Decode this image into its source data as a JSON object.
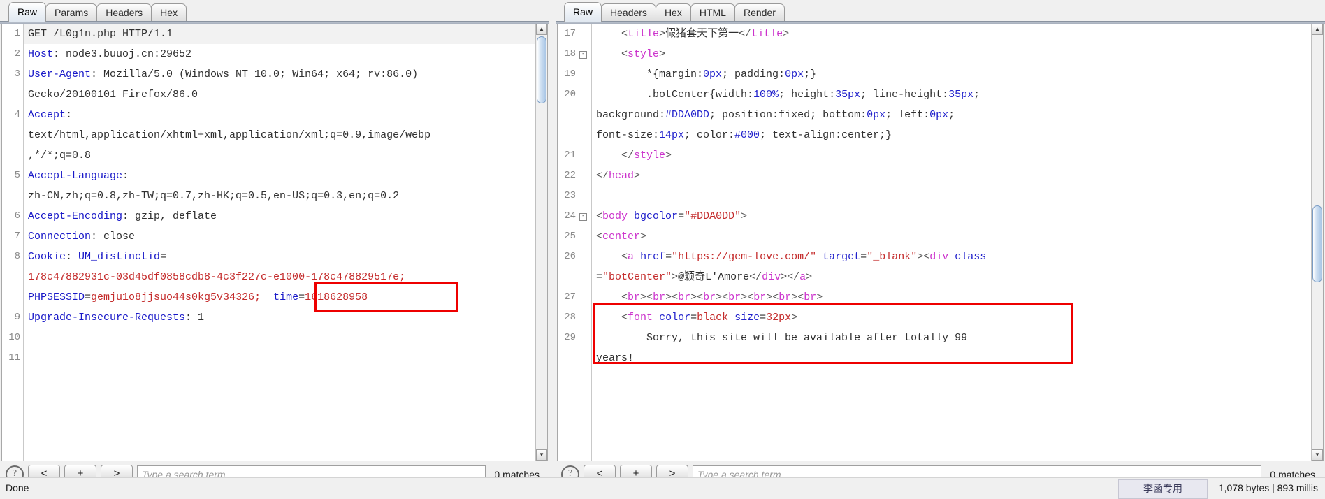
{
  "request": {
    "tabs": [
      {
        "label": "Raw",
        "active": true
      },
      {
        "label": "Params",
        "active": false
      },
      {
        "label": "Headers",
        "active": false
      },
      {
        "label": "Hex",
        "active": false
      }
    ],
    "lines": [
      {
        "n": "1",
        "segments": [
          {
            "t": "GET /L0g1n.php HTTP/1.1",
            "c": "k-plain"
          }
        ]
      },
      {
        "n": "2",
        "segments": [
          {
            "t": "Host",
            "c": "k-blue"
          },
          {
            "t": ": node3.buuoj.cn:29652",
            "c": "k-plain"
          }
        ]
      },
      {
        "n": "3",
        "segments": [
          {
            "t": "User-Agent",
            "c": "k-blue"
          },
          {
            "t": ": Mozilla/5.0 (Windows NT 10.0; Win64; x64; rv:86.0)",
            "c": "k-plain"
          }
        ]
      },
      {
        "n": "",
        "segments": [
          {
            "t": "Gecko/20100101 Firefox/86.0",
            "c": "k-plain"
          }
        ]
      },
      {
        "n": "4",
        "segments": [
          {
            "t": "Accept",
            "c": "k-blue"
          },
          {
            "t": ":",
            "c": "k-plain"
          }
        ]
      },
      {
        "n": "",
        "segments": [
          {
            "t": "text/html,application/xhtml+xml,application/xml;q=0.9,image/webp",
            "c": "k-plain"
          }
        ]
      },
      {
        "n": "",
        "segments": [
          {
            "t": ",*/*;q=0.8",
            "c": "k-plain"
          }
        ]
      },
      {
        "n": "5",
        "segments": [
          {
            "t": "Accept-Language",
            "c": "k-blue"
          },
          {
            "t": ":",
            "c": "k-plain"
          }
        ]
      },
      {
        "n": "",
        "segments": [
          {
            "t": "zh-CN,zh;q=0.8,zh-TW;q=0.7,zh-HK;q=0.5,en-US;q=0.3,en;q=0.2",
            "c": "k-plain"
          }
        ]
      },
      {
        "n": "6",
        "segments": [
          {
            "t": "Accept-Encoding",
            "c": "k-blue"
          },
          {
            "t": ": gzip, deflate",
            "c": "k-plain"
          }
        ]
      },
      {
        "n": "7",
        "segments": [
          {
            "t": "Connection",
            "c": "k-blue"
          },
          {
            "t": ": close",
            "c": "k-plain"
          }
        ]
      },
      {
        "n": "8",
        "segments": [
          {
            "t": "Cookie",
            "c": "k-blue"
          },
          {
            "t": ": ",
            "c": "k-plain"
          },
          {
            "t": "UM_distinctid",
            "c": "k-blue"
          },
          {
            "t": "=",
            "c": "k-plain"
          }
        ]
      },
      {
        "n": "",
        "segments": [
          {
            "t": "178c47882931c-03d45df0858cdb8-4c3f227c-e1000-178c478829517e;",
            "c": "k-red"
          }
        ]
      },
      {
        "n": "",
        "segments": [
          {
            "t": "PHPSESSID",
            "c": "k-blue"
          },
          {
            "t": "=",
            "c": "k-plain"
          },
          {
            "t": "gemju1o8jjsuo44s0kg5v34326;",
            "c": "k-red"
          },
          {
            "t": "  ",
            "c": "k-plain"
          },
          {
            "t": "time",
            "c": "k-blue"
          },
          {
            "t": "=",
            "c": "k-plain"
          },
          {
            "t": "1618628958",
            "c": "k-red"
          }
        ]
      },
      {
        "n": "9",
        "segments": [
          {
            "t": "Upgrade-Insecure-Requests",
            "c": "k-blue"
          },
          {
            "t": ": 1",
            "c": "k-plain"
          }
        ]
      },
      {
        "n": "10",
        "segments": []
      },
      {
        "n": "11",
        "segments": []
      }
    ],
    "search": {
      "help_label": "?",
      "prev_label": "<",
      "add_label": "+",
      "next_label": ">",
      "placeholder": "Type a search term",
      "value": "",
      "matches": "0 matches"
    }
  },
  "response": {
    "tabs": [
      {
        "label": "Raw",
        "active": true
      },
      {
        "label": "Headers",
        "active": false
      },
      {
        "label": "Hex",
        "active": false
      },
      {
        "label": "HTML",
        "active": false
      },
      {
        "label": "Render",
        "active": false
      }
    ],
    "lines": [
      {
        "n": "17",
        "fold": false,
        "indent": 4,
        "segments": [
          {
            "t": "<",
            "c": "k-gray"
          },
          {
            "t": "title",
            "c": "k-mag"
          },
          {
            "t": ">",
            "c": "k-gray"
          },
          {
            "t": "假猪套天下第一",
            "c": "k-plain"
          },
          {
            "t": "</",
            "c": "k-gray"
          },
          {
            "t": "title",
            "c": "k-mag"
          },
          {
            "t": ">",
            "c": "k-gray"
          }
        ]
      },
      {
        "n": "18",
        "fold": true,
        "indent": 4,
        "segments": [
          {
            "t": "<",
            "c": "k-gray"
          },
          {
            "t": "style",
            "c": "k-mag"
          },
          {
            "t": ">",
            "c": "k-gray"
          }
        ]
      },
      {
        "n": "19",
        "fold": false,
        "indent": 8,
        "segments": [
          {
            "t": "*{margin:",
            "c": "k-plain"
          },
          {
            "t": "0px",
            "c": "k-dblue"
          },
          {
            "t": "; padding:",
            "c": "k-plain"
          },
          {
            "t": "0px",
            "c": "k-dblue"
          },
          {
            "t": ";}",
            "c": "k-plain"
          }
        ]
      },
      {
        "n": "20",
        "fold": false,
        "indent": 8,
        "segments": [
          {
            "t": ".botCenter{width:",
            "c": "k-plain"
          },
          {
            "t": "100%",
            "c": "k-dblue"
          },
          {
            "t": "; height:",
            "c": "k-plain"
          },
          {
            "t": "35px",
            "c": "k-dblue"
          },
          {
            "t": "; line-height:",
            "c": "k-plain"
          },
          {
            "t": "35px",
            "c": "k-dblue"
          },
          {
            "t": ";",
            "c": "k-plain"
          }
        ]
      },
      {
        "n": "",
        "fold": false,
        "indent": 0,
        "segments": [
          {
            "t": "background:",
            "c": "k-plain"
          },
          {
            "t": "#DDA0DD",
            "c": "k-dblue"
          },
          {
            "t": "; position:fixed; bottom:",
            "c": "k-plain"
          },
          {
            "t": "0px",
            "c": "k-dblue"
          },
          {
            "t": "; left:",
            "c": "k-plain"
          },
          {
            "t": "0px",
            "c": "k-dblue"
          },
          {
            "t": ";",
            "c": "k-plain"
          }
        ]
      },
      {
        "n": "",
        "fold": false,
        "indent": 0,
        "segments": [
          {
            "t": "font-size:",
            "c": "k-plain"
          },
          {
            "t": "14px",
            "c": "k-dblue"
          },
          {
            "t": "; color:",
            "c": "k-plain"
          },
          {
            "t": "#000",
            "c": "k-dblue"
          },
          {
            "t": "; text-align:center;}",
            "c": "k-plain"
          }
        ]
      },
      {
        "n": "21",
        "fold": false,
        "indent": 4,
        "segments": [
          {
            "t": "</",
            "c": "k-gray"
          },
          {
            "t": "style",
            "c": "k-mag"
          },
          {
            "t": ">",
            "c": "k-gray"
          }
        ]
      },
      {
        "n": "22",
        "fold": false,
        "indent": 0,
        "segments": [
          {
            "t": "</",
            "c": "k-gray"
          },
          {
            "t": "head",
            "c": "k-mag"
          },
          {
            "t": ">",
            "c": "k-gray"
          }
        ]
      },
      {
        "n": "23",
        "fold": false,
        "indent": 0,
        "segments": []
      },
      {
        "n": "24",
        "fold": true,
        "indent": 0,
        "segments": [
          {
            "t": "<",
            "c": "k-gray"
          },
          {
            "t": "body",
            "c": "k-mag"
          },
          {
            "t": " ",
            "c": "k-plain"
          },
          {
            "t": "bgcolor",
            "c": "k-dblue"
          },
          {
            "t": "=",
            "c": "k-plain"
          },
          {
            "t": "\"#DDA0DD\"",
            "c": "k-red"
          },
          {
            "t": ">",
            "c": "k-gray"
          }
        ]
      },
      {
        "n": "25",
        "fold": false,
        "indent": 0,
        "segments": [
          {
            "t": "<",
            "c": "k-gray"
          },
          {
            "t": "center",
            "c": "k-mag"
          },
          {
            "t": ">",
            "c": "k-gray"
          }
        ]
      },
      {
        "n": "26",
        "fold": false,
        "indent": 4,
        "segments": [
          {
            "t": "<",
            "c": "k-gray"
          },
          {
            "t": "a",
            "c": "k-mag"
          },
          {
            "t": " ",
            "c": "k-plain"
          },
          {
            "t": "href",
            "c": "k-dblue"
          },
          {
            "t": "=",
            "c": "k-plain"
          },
          {
            "t": "\"https://gem-love.com/\"",
            "c": "k-red"
          },
          {
            "t": " ",
            "c": "k-plain"
          },
          {
            "t": "target",
            "c": "k-dblue"
          },
          {
            "t": "=",
            "c": "k-plain"
          },
          {
            "t": "\"_blank\"",
            "c": "k-red"
          },
          {
            "t": ">",
            "c": "k-gray"
          },
          {
            "t": "<",
            "c": "k-gray"
          },
          {
            "t": "div",
            "c": "k-mag"
          },
          {
            "t": " ",
            "c": "k-plain"
          },
          {
            "t": "class",
            "c": "k-dblue"
          }
        ]
      },
      {
        "n": "",
        "fold": false,
        "indent": 0,
        "segments": [
          {
            "t": "=",
            "c": "k-plain"
          },
          {
            "t": "\"botCenter\"",
            "c": "k-red"
          },
          {
            "t": ">",
            "c": "k-gray"
          },
          {
            "t": "@颖奇L'Amore",
            "c": "k-plain"
          },
          {
            "t": "</",
            "c": "k-gray"
          },
          {
            "t": "div",
            "c": "k-mag"
          },
          {
            "t": ">",
            "c": "k-gray"
          },
          {
            "t": "</",
            "c": "k-gray"
          },
          {
            "t": "a",
            "c": "k-mag"
          },
          {
            "t": ">",
            "c": "k-gray"
          }
        ]
      },
      {
        "n": "27",
        "fold": false,
        "indent": 4,
        "segments": [
          {
            "t": "<",
            "c": "k-gray"
          },
          {
            "t": "br",
            "c": "k-mag"
          },
          {
            "t": "><",
            "c": "k-gray"
          },
          {
            "t": "br",
            "c": "k-mag"
          },
          {
            "t": "><",
            "c": "k-gray"
          },
          {
            "t": "br",
            "c": "k-mag"
          },
          {
            "t": "><",
            "c": "k-gray"
          },
          {
            "t": "br",
            "c": "k-mag"
          },
          {
            "t": "><",
            "c": "k-gray"
          },
          {
            "t": "br",
            "c": "k-mag"
          },
          {
            "t": "><",
            "c": "k-gray"
          },
          {
            "t": "br",
            "c": "k-mag"
          },
          {
            "t": "><",
            "c": "k-gray"
          },
          {
            "t": "br",
            "c": "k-mag"
          },
          {
            "t": "><",
            "c": "k-gray"
          },
          {
            "t": "br",
            "c": "k-mag"
          },
          {
            "t": ">",
            "c": "k-gray"
          }
        ]
      },
      {
        "n": "28",
        "fold": false,
        "indent": 4,
        "segments": [
          {
            "t": "<",
            "c": "k-gray"
          },
          {
            "t": "font",
            "c": "k-mag"
          },
          {
            "t": " ",
            "c": "k-plain"
          },
          {
            "t": "color",
            "c": "k-dblue"
          },
          {
            "t": "=",
            "c": "k-plain"
          },
          {
            "t": "black",
            "c": "k-red"
          },
          {
            "t": " ",
            "c": "k-plain"
          },
          {
            "t": "size",
            "c": "k-dblue"
          },
          {
            "t": "=",
            "c": "k-plain"
          },
          {
            "t": "32px",
            "c": "k-red"
          },
          {
            "t": ">",
            "c": "k-gray"
          }
        ]
      },
      {
        "n": "29",
        "fold": false,
        "indent": 8,
        "segments": [
          {
            "t": "Sorry, this site will be available after totally 99",
            "c": "k-plain"
          }
        ]
      },
      {
        "n": "",
        "fold": false,
        "indent": 0,
        "segments": [
          {
            "t": "years!",
            "c": "k-plain"
          }
        ]
      }
    ],
    "search": {
      "help_label": "?",
      "prev_label": "<",
      "add_label": "+",
      "next_label": ">",
      "placeholder": "Type a search term",
      "value": "",
      "matches": "0 matches"
    }
  },
  "statusbar": {
    "left": "Done",
    "right": "1,078 bytes | 893 millis",
    "watermark": "李函专用"
  },
  "annotations": {
    "accent_color": "#ee0000",
    "boxes": [
      {
        "name": "time-cookie-highlight",
        "target": "time=1618628958"
      },
      {
        "name": "99-years-message-highlight",
        "target": "Sorry, this site will be available after totally 99 years!"
      }
    ]
  },
  "scrollbars": {
    "request_up": "▲",
    "request_down": "▼",
    "response_up": "▲",
    "response_down": "▼"
  }
}
